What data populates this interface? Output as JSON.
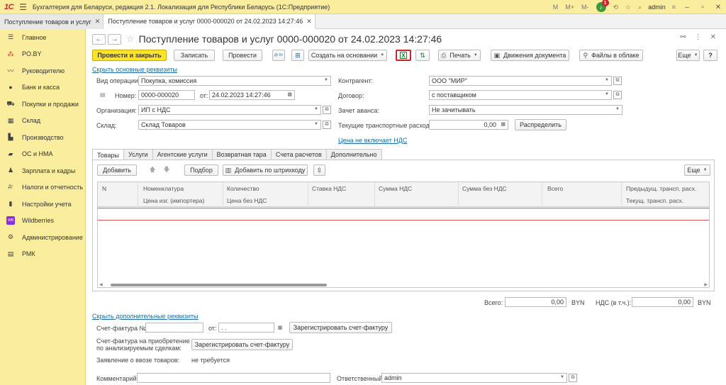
{
  "titlebar": {
    "logo": "1С",
    "app_title": "Бухгалтерия для Беларуси, редакция 2.1. Локализация для Республики Беларусь  (1С:Предприятие)",
    "m": "M",
    "mplus": "M+",
    "mminus": "M-",
    "notif_count": "1",
    "user": "admin"
  },
  "tabs": [
    {
      "label": "Поступление товаров и услуг"
    },
    {
      "label": "Поступление товаров и услуг 0000-000020 от 24.02.2023 14:27:46"
    }
  ],
  "sidebar": {
    "items": [
      {
        "label": "Главное",
        "icon": "list-icon"
      },
      {
        "label": "PO.BY",
        "icon": "asterisk-icon"
      },
      {
        "label": "Руководителю",
        "icon": "trend-icon"
      },
      {
        "label": "Банк и касса",
        "icon": "coin-icon"
      },
      {
        "label": "Покупки и продажи",
        "icon": "cart-icon"
      },
      {
        "label": "Склад",
        "icon": "warehouse-icon"
      },
      {
        "label": "Производство",
        "icon": "factory-icon"
      },
      {
        "label": "ОС и НМА",
        "icon": "truck-icon"
      },
      {
        "label": "Зарплата и кадры",
        "icon": "person-icon"
      },
      {
        "label": "Налоги и отчетность",
        "icon": "tax-icon"
      },
      {
        "label": "Настройки учета",
        "icon": "book-icon"
      },
      {
        "label": "Wildberries",
        "icon": "wb-icon"
      },
      {
        "label": "Администрирование",
        "icon": "gear-icon"
      },
      {
        "label": "РМК",
        "icon": "register-icon"
      }
    ]
  },
  "document": {
    "title": "Поступление товаров и услуг 0000-000020 от 24.02.2023 14:27:46"
  },
  "toolbar": {
    "post_close": "Провести и закрыть",
    "save": "Записать",
    "post": "Провести",
    "dt_kt": "Дт Кт",
    "create_based": "Создать на основании",
    "print": "Печать",
    "movements": "Движения документа",
    "cloud_files": "Файлы в облаке",
    "more": "Еще",
    "help": "?"
  },
  "form": {
    "hide_main_link": "Скрыть основные реквизиты",
    "op_type_label": "Вид операции:",
    "op_type_value": "Покупка, комиссия",
    "number_label": "Номер:",
    "number_value": "0000-000020",
    "date_label": "от:",
    "date_value": "24.02.2023 14:27:46",
    "org_label": "Организация:",
    "org_value": "ИП с НДС",
    "warehouse_label": "Склад:",
    "warehouse_value": "Склад Товаров",
    "contractor_label": "Контрагент:",
    "contractor_value": "ООО \"МИР\"",
    "contract_label": "Договор:",
    "contract_value": "с поставщиком",
    "advance_label": "Зачет аванса:",
    "advance_value": "Не зачитывать",
    "transport_label": "Текущие транспортные расходы:",
    "transport_value": "0,00",
    "distribute": "Распределить",
    "vat_link": "Цена не включает НДС"
  },
  "form_tabs": [
    {
      "label": "Товары"
    },
    {
      "label": "Услуги"
    },
    {
      "label": "Агентские услуги"
    },
    {
      "label": "Возвратная тара"
    },
    {
      "label": "Счета расчетов"
    },
    {
      "label": "Дополнительно"
    }
  ],
  "goods": {
    "add": "Добавить",
    "pick": "Подбор",
    "add_barcode": "Добавить по штрихкоду",
    "more": "Еще",
    "columns": {
      "n": "N",
      "nomenclature": "Номенклатура",
      "importer_price": "Цена изг. (импортера)",
      "quantity": "Количество",
      "price_no_vat": "Цена без НДС",
      "vat_rate": "Ставка НДС",
      "vat_sum": "Сумма НДС",
      "sum_no_vat": "Сумма без НДС",
      "total": "Всего",
      "prev_transport": "Предыдущ. трансп. расх.",
      "cur_transport": "Текущ. трансп. расх."
    }
  },
  "totals": {
    "total_label": "Всего:",
    "total_value": "0,00",
    "total_currency": "BYN",
    "vat_label": "НДС (в т.ч.):",
    "vat_value": "0,00",
    "vat_currency": "BYN"
  },
  "extra": {
    "hide_extra_link": "Скрыть дополнительные реквизиты",
    "invoice_label": "Счет-фактура №:",
    "invoice_value": "",
    "invoice_date_label": "от:",
    "invoice_date_value": " .  .",
    "register_invoice": "Зарегистрировать счет-фактуру",
    "invoice_acq_label_1": "Счет-фактура на приобретение",
    "invoice_acq_label_2": "по анализируемым сделкам:",
    "register_invoice_2": "Зарегистрировать счет-фактуру",
    "import_label": "Заявление о ввозе товаров:",
    "import_value": "не требуется",
    "comment_label": "Комментарий:",
    "comment_value": "",
    "responsible_label": "Ответственный:",
    "responsible_value": "admin"
  },
  "colors": {
    "sidebar_bg": "#fbed9e",
    "primary_btn": "#ffe326",
    "link": "#1a6fa8",
    "excel_highlight": "#d2232a"
  }
}
